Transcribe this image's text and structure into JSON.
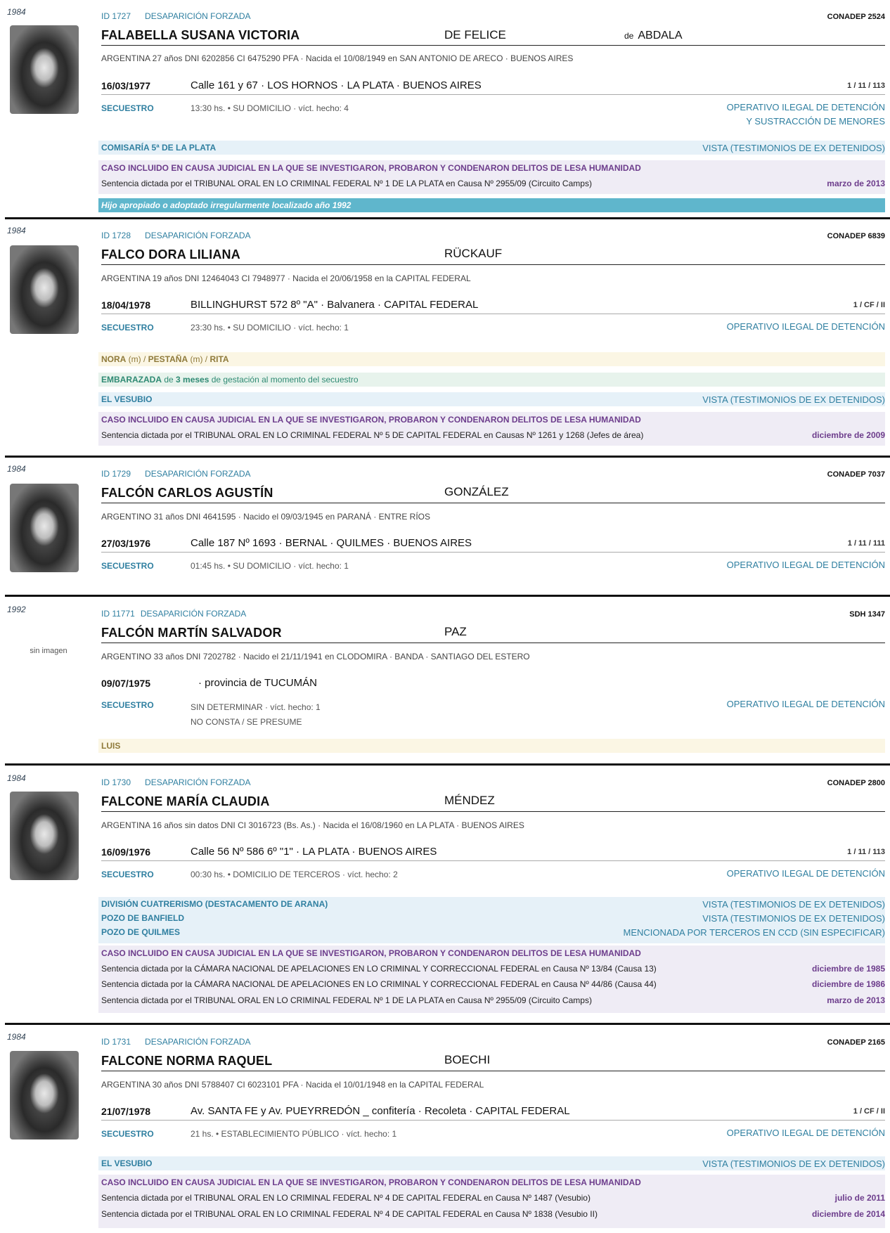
{
  "records": [
    {
      "year": "1984",
      "id": "ID 1727",
      "label": "DESAPARICIÓN FORZADA",
      "source": "CONADEP  2524",
      "name": "FALABELLA  SUSANA VICTORIA",
      "surname2": "DE FELICE",
      "husband_prefix": "de",
      "husband": "ABDALA",
      "info": "ARGENTINA   27 años   DNI 6202856   CI 6475290 PFA  ·  Nacida el 10/08/1949 en SAN ANTONIO DE ARECO · BUENOS AIRES",
      "date": "16/03/1977",
      "address": "Calle 161 y 67   ·   LOS HORNOS · LA PLATA · BUENOS AIRES",
      "ref": "1 / 11 / 113",
      "secuestro": "SECUESTRO",
      "sec_detail": "13:30 hs.  •  SU DOMICILIO  ·  víct. hecho: 4",
      "op_line1": "OPERATIVO ILEGAL DE DETENCIÓN",
      "op_line2": "Y SUSTRACCIÓN DE MENORES",
      "ccd": [
        {
          "name": "COMISARÍA 5ª DE LA PLATA",
          "status": "VISTA (TESTIMONIOS DE EX DETENIDOS)"
        }
      ],
      "causa_header": "CASO INCLUIDO EN CAUSA JUDICIAL EN LA QUE SE INVESTIGARON, PROBARON Y CONDENARON DELITOS DE LESA HUMANIDAD",
      "sentencias": [
        {
          "text": "Sentencia dictada por el TRIBUNAL ORAL EN LO CRIMINAL FEDERAL Nº 1 DE LA PLATA en Causa Nº 2955/09 (Circuito Camps)",
          "date": "marzo de 2013"
        }
      ],
      "hijo": "Hijo apropiado o adoptado irregularmente localizado año 1992"
    },
    {
      "year": "1984",
      "id": "ID 1728",
      "label": "DESAPARICIÓN FORZADA",
      "source": "CONADEP  6839",
      "name": "FALCO  DORA LILIANA",
      "surname2": "RÜCKAUF",
      "info": "ARGENTINA   19 años   DNI 12464043   CI 7948977  ·  Nacida el 20/06/1958 en la CAPITAL FEDERAL",
      "date": "18/04/1978",
      "address": "BILLINGHURST 572  8º \"A\"  ·  Balvanera  ·  CAPITAL FEDERAL",
      "ref": "1 / CF / II",
      "secuestro": "SECUESTRO",
      "sec_detail": "23:30 hs.  •  SU DOMICILIO  ·  víct. hecho: 1",
      "op_line1": "OPERATIVO ILEGAL DE DETENCIÓN",
      "alias": {
        "a1": "NORA",
        "m1": " (m) / ",
        "a2": "PESTAÑA",
        "m2": " (m) / ",
        "a3": "RITA"
      },
      "preg": {
        "b1": "EMBARAZADA",
        "t1": " de ",
        "b2": "3 meses",
        "t2": " de gestación al momento del secuestro"
      },
      "ccd": [
        {
          "name": "EL VESUBIO",
          "status": "VISTA (TESTIMONIOS DE EX DETENIDOS)"
        }
      ],
      "causa_header": "CASO INCLUIDO EN CAUSA JUDICIAL EN LA QUE SE INVESTIGARON, PROBARON Y CONDENARON DELITOS DE LESA HUMANIDAD",
      "sentencias": [
        {
          "text": "Sentencia dictada por el TRIBUNAL ORAL EN LO CRIMINAL FEDERAL Nº 5 DE CAPITAL FEDERAL en Causas Nº 1261 y 1268 (Jefes de área)",
          "date": "diciembre de 2009"
        }
      ]
    },
    {
      "year": "1984",
      "id": "ID 1729",
      "label": "DESAPARICIÓN FORZADA",
      "source": "CONADEP  7037",
      "name": "FALCÓN  CARLOS AGUSTÍN",
      "surname2": "GONZÁLEZ",
      "info": "ARGENTINO   31 años   DNI 4641595  ·  Nacido el 09/03/1945 en PARANÁ · ENTRE RÍOS",
      "date": "27/03/1976",
      "address": "Calle 187 Nº 1693   ·   BERNAL · QUILMES · BUENOS AIRES",
      "ref": "1 / 11 / 111",
      "secuestro": "SECUESTRO",
      "sec_detail": "01:45 hs.  •  SU DOMICILIO  ·  víct. hecho: 1",
      "op_line1": "OPERATIVO ILEGAL DE DETENCIÓN"
    },
    {
      "year": "1992",
      "id": "ID 11771",
      "label": "DESAPARICIÓN FORZADA",
      "source": "SDH  1347",
      "name": "FALCÓN  MARTÍN SALVADOR",
      "surname2": "PAZ",
      "no_image": "sin imagen",
      "info": "ARGENTINO   33 años   DNI 7202782  ·  Nacido el 21/11/1941 en CLODOMIRA · BANDA · SANTIAGO DEL ESTERO",
      "date": "09/07/1975",
      "address": "·  provincia de TUCUMÁN",
      "secuestro": "SECUESTRO",
      "sec_detail": "SIN DETERMINAR  ·  víct. hecho: 1",
      "sec_detail2": "NO CONSTA / SE PRESUME",
      "op_line1": "OPERATIVO ILEGAL DE DETENCIÓN",
      "alias": {
        "a1": "LUIS"
      }
    },
    {
      "year": "1984",
      "id": "ID 1730",
      "label": "DESAPARICIÓN FORZADA",
      "source": "CONADEP  2800",
      "name": "FALCONE  MARÍA CLAUDIA",
      "surname2": "MÉNDEZ",
      "info": "ARGENTINA   16 años   sin datos DNI   CI 3016723 (Bs. As.)  ·  Nacida el 16/08/1960 en LA PLATA · BUENOS AIRES",
      "date": "16/09/1976",
      "address": "Calle 56 Nº 586  6º \"1\"   ·   LA PLATA · BUENOS AIRES",
      "ref": "1 / 11 / 113",
      "secuestro": "SECUESTRO",
      "sec_detail": "00:30 hs.  •  DOMICILIO DE TERCEROS  ·  víct. hecho: 2",
      "op_line1": "OPERATIVO ILEGAL DE DETENCIÓN",
      "ccd": [
        {
          "name": "DIVISIÓN CUATRERISMO (DESTACAMENTO DE ARANA)",
          "status": "VISTA (TESTIMONIOS DE EX DETENIDOS)"
        },
        {
          "name": "POZO DE BANFIELD",
          "status": "VISTA (TESTIMONIOS DE EX DETENIDOS)"
        },
        {
          "name": "POZO DE QUILMES",
          "status": "MENCIONADA POR TERCEROS EN CCD (SIN ESPECIFICAR)"
        }
      ],
      "causa_header": "CASO INCLUIDO EN CAUSA JUDICIAL EN LA QUE SE INVESTIGARON, PROBARON Y CONDENARON DELITOS DE LESA HUMANIDAD",
      "sentencias": [
        {
          "text": "Sentencia dictada por la CÁMARA NACIONAL DE APELACIONES EN LO CRIMINAL Y CORRECCIONAL FEDERAL en Causa Nº 13/84 (Causa 13)",
          "date": "diciembre de 1985"
        },
        {
          "text": "Sentencia dictada por la CÁMARA NACIONAL DE APELACIONES EN LO CRIMINAL Y CORRECCIONAL FEDERAL en Causa Nº 44/86 (Causa 44)",
          "date": "diciembre de 1986"
        },
        {
          "text": "Sentencia dictada por el TRIBUNAL ORAL EN LO CRIMINAL FEDERAL Nº 1 DE LA PLATA en Causa Nº 2955/09 (Circuito Camps)",
          "date": "marzo de 2013"
        }
      ]
    },
    {
      "year": "1984",
      "id": "ID 1731",
      "label": "DESAPARICIÓN FORZADA",
      "source": "CONADEP  2165",
      "name": "FALCONE  NORMA RAQUEL",
      "surname2": "BOECHI",
      "info": "ARGENTINA   30 años   DNI 5788407   CI 6023101 PFA  ·  Nacida el 10/01/1948 en la CAPITAL FEDERAL",
      "date": "21/07/1978",
      "address": "Av. SANTA FE y Av. PUEYRREDÓN _ confitería  ·  Recoleta  ·  CAPITAL FEDERAL",
      "ref": "1 / CF / II",
      "secuestro": "SECUESTRO",
      "sec_detail": "21 hs.  •  ESTABLECIMIENTO PÚBLICO  ·  víct. hecho: 1",
      "op_line1": "OPERATIVO ILEGAL DE DETENCIÓN",
      "ccd": [
        {
          "name": "EL VESUBIO",
          "status": "VISTA (TESTIMONIOS DE EX DETENIDOS)"
        }
      ],
      "causa_header": "CASO INCLUIDO EN CAUSA JUDICIAL EN LA QUE SE INVESTIGARON, PROBARON Y CONDENARON DELITOS DE LESA HUMANIDAD",
      "sentencias": [
        {
          "text": "Sentencia dictada por el TRIBUNAL ORAL EN LO CRIMINAL FEDERAL Nº 4 DE CAPITAL FEDERAL en Causa Nº 1487 (Vesubio)",
          "date": "julio de 2011"
        },
        {
          "text": "Sentencia dictada por el TRIBUNAL ORAL EN LO CRIMINAL FEDERAL Nº 4 DE CAPITAL FEDERAL en Causa Nº 1838 (Vesubio II)",
          "date": "diciembre de 2014"
        }
      ]
    }
  ]
}
